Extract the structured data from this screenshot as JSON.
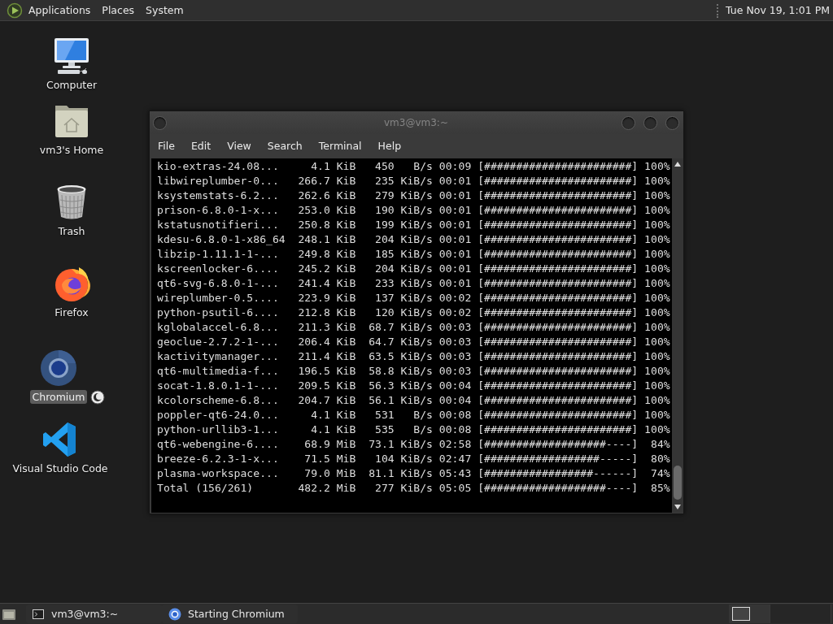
{
  "top_panel": {
    "menus": [
      {
        "label": "Applications"
      },
      {
        "label": "Places"
      },
      {
        "label": "System"
      }
    ],
    "clock": "Tue Nov 19, 1:01 PM"
  },
  "desktop_icons": [
    {
      "kind": "computer",
      "label": "Computer",
      "selected": false,
      "emblem": false
    },
    {
      "kind": "home",
      "label": "vm3's Home",
      "selected": false,
      "emblem": false
    },
    {
      "kind": "trash",
      "label": "Trash",
      "selected": false,
      "emblem": false
    },
    {
      "kind": "firefox",
      "label": "Firefox",
      "selected": false,
      "emblem": false
    },
    {
      "kind": "chromium",
      "label": "Chromium",
      "selected": true,
      "emblem": true
    },
    {
      "kind": "vscode",
      "label": "Visual Studio Code",
      "selected": false,
      "emblem": false
    }
  ],
  "terminal": {
    "title": "vm3@vm3:~",
    "menu": [
      "File",
      "Edit",
      "View",
      "Search",
      "Terminal",
      "Help"
    ],
    "lines": [
      "kio-extras-24.08...     4.1 KiB   450   B/s 00:09 [#######################] 100%",
      "libwireplumber-0...   266.7 KiB   235 KiB/s 00:01 [#######################] 100%",
      "ksystemstats-6.2...   262.6 KiB   279 KiB/s 00:01 [#######################] 100%",
      "prison-6.8.0-1-x...   253.0 KiB   190 KiB/s 00:01 [#######################] 100%",
      "kstatusnotifieri...   250.8 KiB   199 KiB/s 00:01 [#######################] 100%",
      "kdesu-6.8.0-1-x86_64  248.1 KiB   204 KiB/s 00:01 [#######################] 100%",
      "libzip-1.11.1-1-...   249.8 KiB   185 KiB/s 00:01 [#######################] 100%",
      "kscreenlocker-6....   245.2 KiB   204 KiB/s 00:01 [#######################] 100%",
      "qt6-svg-6.8.0-1-...   241.4 KiB   233 KiB/s 00:01 [#######################] 100%",
      "wireplumber-0.5....   223.9 KiB   137 KiB/s 00:02 [#######################] 100%",
      "python-psutil-6....   212.8 KiB   120 KiB/s 00:02 [#######################] 100%",
      "kglobalaccel-6.8...   211.3 KiB  68.7 KiB/s 00:03 [#######################] 100%",
      "geoclue-2.7.2-1-...   206.4 KiB  64.7 KiB/s 00:03 [#######################] 100%",
      "kactivitymanager...   211.4 KiB  63.5 KiB/s 00:03 [#######################] 100%",
      "qt6-multimedia-f...   196.5 KiB  58.8 KiB/s 00:03 [#######################] 100%",
      "socat-1.8.0.1-1-...   209.5 KiB  56.3 KiB/s 00:04 [#######################] 100%",
      "kcolorscheme-6.8...   204.7 KiB  56.1 KiB/s 00:04 [#######################] 100%",
      "poppler-qt6-24.0...     4.1 KiB   531   B/s 00:08 [#######################] 100%",
      "python-urllib3-1...     4.1 KiB   535   B/s 00:08 [#######################] 100%",
      "qt6-webengine-6....    68.9 MiB  73.1 KiB/s 02:58 [###################----]  84%",
      "breeze-6.2.3-1-x...    71.5 MiB   104 KiB/s 02:47 [##################-----]  80%",
      "plasma-workspace...    79.0 MiB  81.1 KiB/s 05:43 [#################------]  74%",
      "Total (156/261)       482.2 MiB   277 KiB/s 05:05 [###################----]  85%"
    ]
  },
  "taskbar": {
    "tasks": [
      {
        "kind": "terminal",
        "label": "vm3@vm3:~"
      },
      {
        "kind": "chromium",
        "label": "Starting Chromium"
      }
    ]
  }
}
